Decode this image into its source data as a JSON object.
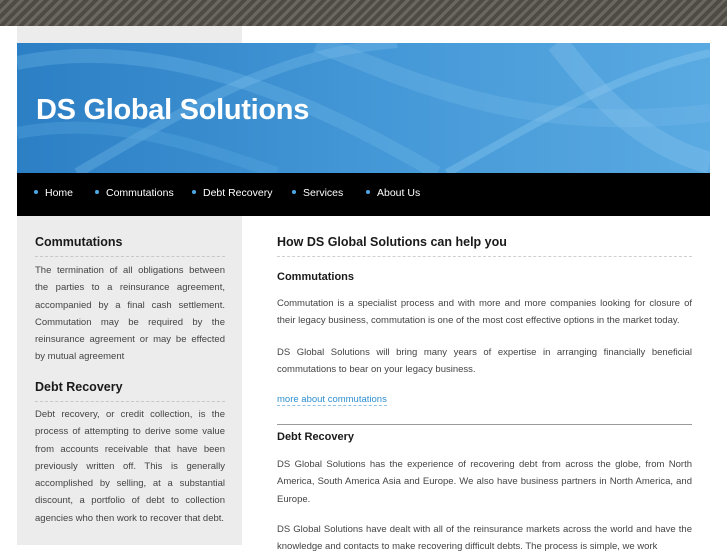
{
  "header": {
    "title": "DS Global Solutions"
  },
  "nav": {
    "items": [
      "Home",
      "Commutations",
      "Debt Recovery",
      "Services",
      "About Us"
    ]
  },
  "sidebar": {
    "sections": [
      {
        "heading": "Commutations",
        "text": "The termination of all obligations between the parties to a reinsurance agreement, accompanied by a final cash settlement. Commutation may be required by the reinsurance agreement or may be effected by mutual agreement"
      },
      {
        "heading": "Debt Recovery",
        "text": "Debt recovery, or credit collection, is the process of attempting to derive some value from accounts receivable that have been previously written off. This is generally accomplished by selling, at a substantial discount, a portfolio of debt to collection agencies who then work to recover that debt."
      }
    ]
  },
  "main": {
    "heading": "How DS Global Solutions can help you",
    "commutations": {
      "title": "Commutations",
      "p1": "Commutation is a specialist process and with more and more companies looking for closure of their legacy business, commutation is one of the most cost effective options in the market today.",
      "p2": "DS Global Solutions will bring many years of expertise in arranging financially beneficial commutations to bear on your legacy business.",
      "link": "more about commutations"
    },
    "debt_recovery": {
      "title": "Debt Recovery",
      "p1": "DS Global Solutions has the experience of recovering debt from across the globe, from North America, South America Asia and Europe.  We also have business partners in North America, and Europe.",
      "p2": "DS Global Solutions have dealt with all of the reinsurance markets across the world and have the knowledge and contacts to make recovering difficult debts. The process is simple, we work"
    }
  },
  "colors": {
    "header_blue": "#3d8fd0",
    "nav_bg": "#000000",
    "nav_bullet": "#4ea8e6",
    "link": "#2f8fd0",
    "sidebar_bg": "#ececec"
  }
}
